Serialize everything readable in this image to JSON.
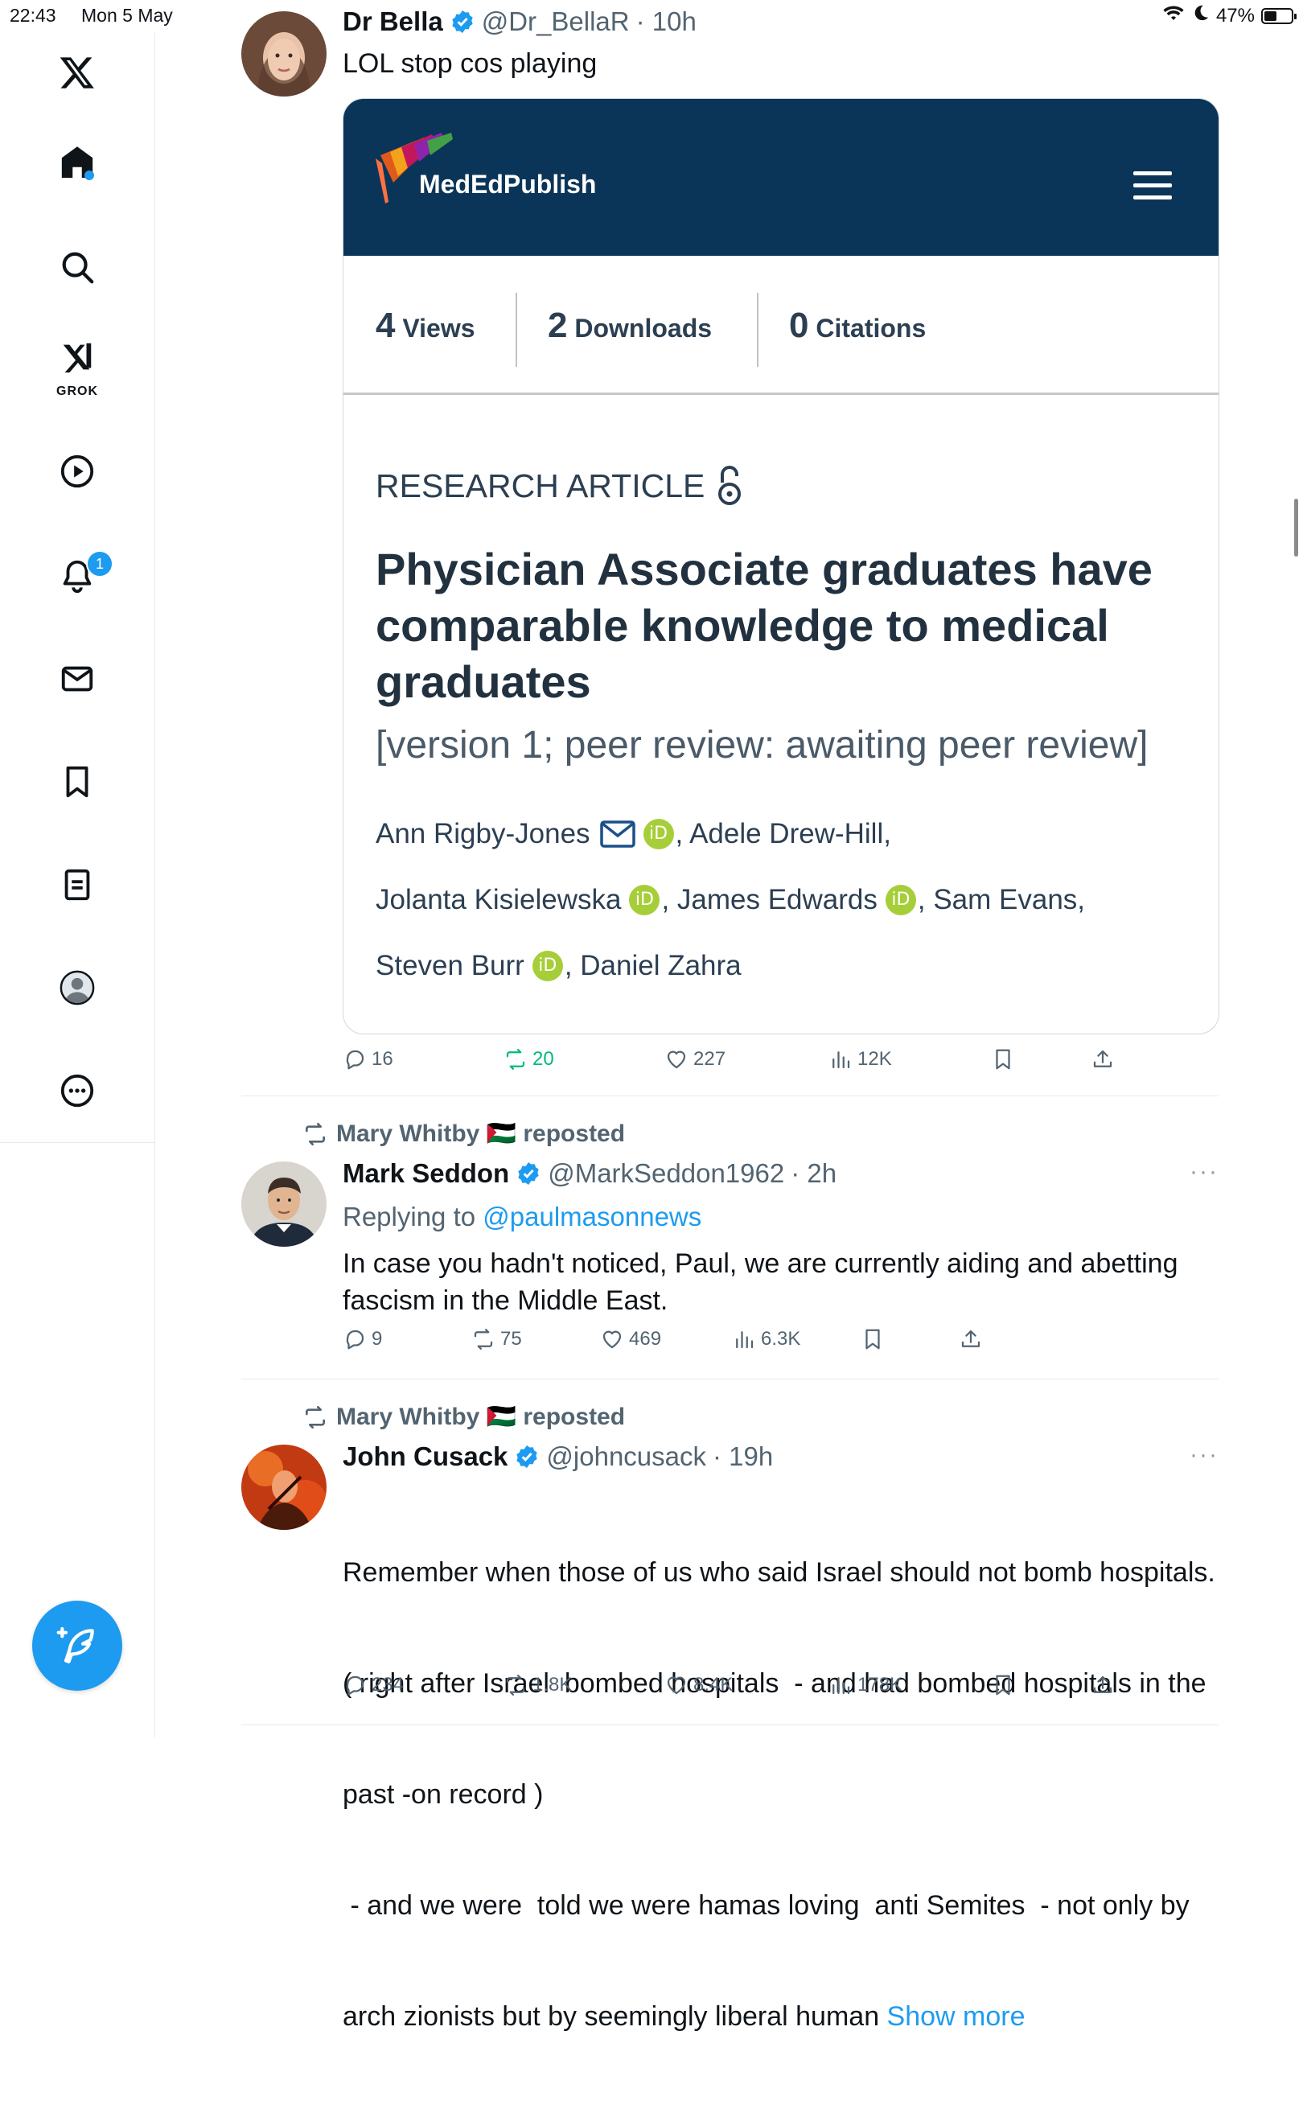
{
  "status_bar": {
    "time": "22:43",
    "date": "Mon 5 May",
    "battery": "47%",
    "battery_level": 0.47
  },
  "sidebar": {
    "grok_label": "GROK",
    "notification_count": "1"
  },
  "tweets": [
    {
      "name": "Dr Bella",
      "handle": "@Dr_BellaR",
      "time": "· 10h",
      "text": "LOL stop cos playing",
      "card": {
        "brand": "MedEdPublish",
        "metrics": [
          {
            "n": "4",
            "label": "Views"
          },
          {
            "n": "2",
            "label": "Downloads"
          },
          {
            "n": "0",
            "label": "Citations"
          }
        ],
        "article_type": "RESEARCH ARTICLE",
        "title": "Physician Associate graduates have comparable knowledge to medical graduates",
        "version": "[version 1; peer review: awaiting peer review]",
        "authors": {
          "a1": "Ann Rigby-Jones",
          "a2": ", Adele Drew-Hill,",
          "a3": "Jolanta Kisielewska",
          "a4": ", James Edwards",
          "a5": ", Sam Evans,",
          "a6": "Steven Burr",
          "a7": ", Daniel Zahra",
          "orcid": "iD"
        }
      },
      "actions": {
        "replies": "16",
        "reposts": "20",
        "likes": "227",
        "views": "12K"
      }
    },
    {
      "repost_by": "Mary Whitby 🇵🇸 reposted",
      "name": "Mark Seddon",
      "handle": "@MarkSeddon1962",
      "time": "· 2h",
      "replying_prefix": "Replying to",
      "replying_handle": "@paulmasonnews",
      "text": "In case you hadn't noticed, Paul, we are currently aiding and abetting fascism in the Middle East.",
      "more": "···",
      "actions": {
        "replies": "9",
        "reposts": "75",
        "likes": "469",
        "views": "6.3K"
      }
    },
    {
      "repost_by": "Mary Whitby 🇵🇸 reposted",
      "name": "John Cusack",
      "handle": "@johncusack",
      "time": "· 19h",
      "text_lines": [
        "Remember when those of us who said Israel should not bomb hospitals.",
        "( right after Israel  bombed hospitals  - and had bombed hospitals in the",
        "past -on record )",
        " - and we were  told we were hamas loving  anti Semites  - not only by",
        "arch zionists but by seemingly liberal human "
      ],
      "show_more": "Show more",
      "more": "···",
      "actions": {
        "replies": "234",
        "reposts": "1.8K",
        "likes": "8.4K",
        "views": "178K"
      }
    }
  ],
  "colors": {
    "accent": "#1d9bf0",
    "repost_green": "#00ba7c",
    "card_header": "#0b3558",
    "orcid_green": "#a6ce39"
  }
}
